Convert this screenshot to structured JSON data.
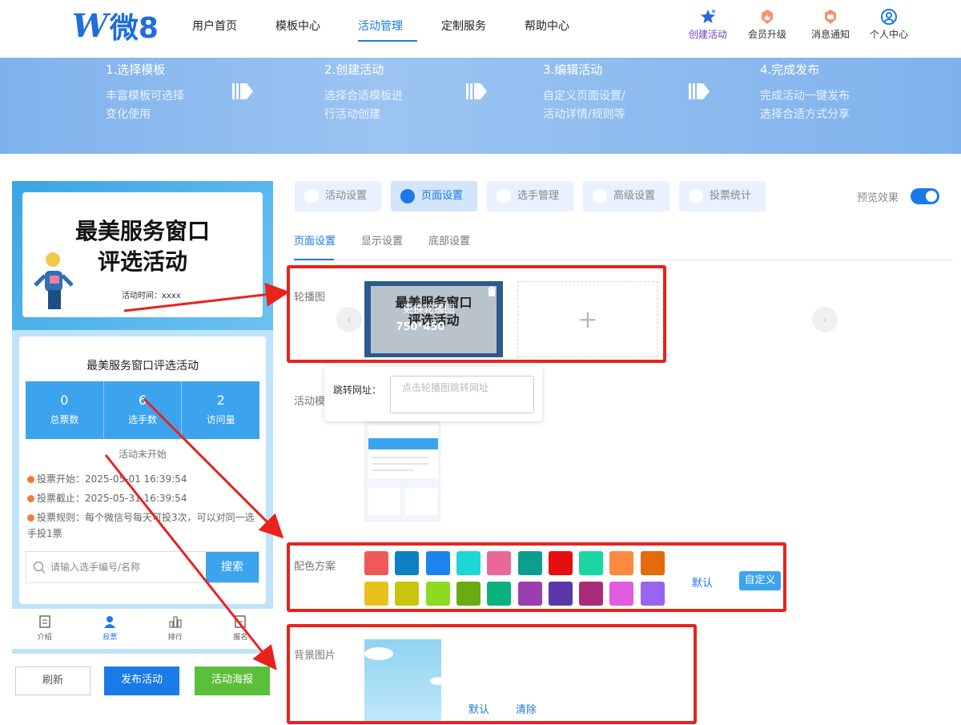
{
  "nav": {
    "logo_mark": "W",
    "logo_text": "微8",
    "links": [
      "用户首页",
      "模板中心",
      "活动管理",
      "定制服务",
      "帮助中心"
    ],
    "right_items": [
      "创建活动",
      "会员升级",
      "消息通知",
      "个人中心"
    ]
  },
  "steps": [
    {
      "title": "1.选择模板",
      "desc1": "丰富模板可选择",
      "desc2": "变化使用"
    },
    {
      "title": "2.创建活动",
      "desc1": "选择合适模板进",
      "desc2": "行活动创建"
    },
    {
      "title": "3.编辑活动",
      "desc1": "自定义页面设置/",
      "desc2": "活动详情/规则等"
    },
    {
      "title": "4.完成发布",
      "desc1": "完成活动一键发布",
      "desc2": "选择合适方式分享"
    }
  ],
  "preview": {
    "banner_title_1": "最美服务窗口",
    "banner_title_2": "评选活动",
    "banner_time": "活动时间：xxxx",
    "activity_name": "最美服务窗口评选活动",
    "stats": [
      {
        "value": "0",
        "label": "总票数"
      },
      {
        "value": "6",
        "label": "选手数"
      },
      {
        "value": "2",
        "label": "访问量"
      }
    ],
    "status": "活动未开始",
    "rules": [
      "投票开始：2025-05-01 16:39:54",
      "投票截止：2025-05-31 16:39:54",
      "投票规则：每个微信号每天可投3次，可以对同一选手投1票"
    ],
    "search_placeholder": "请输入选手编号/名称",
    "search_button": "搜索",
    "tabbar": [
      "介绍",
      "投票",
      "排行",
      "报名"
    ],
    "buttons": [
      "刷新",
      "发布活动",
      "活动海报"
    ]
  },
  "settings": {
    "top_tabs": [
      "活动设置",
      "页面设置",
      "选手管理",
      "高级设置",
      "投票统计"
    ],
    "preview_toggle_label": "预览效果",
    "sub_tabs": [
      "页面设置",
      "显示设置",
      "底部设置"
    ],
    "carousel_label": "轮播图",
    "carousel_overlay": "更换轮播图",
    "carousel_size": "750*450",
    "carousel_thumb_title_1": "最美服务窗口",
    "carousel_thumb_title_2": "评选活动",
    "add_symbol": "+",
    "prev_symbol": "‹",
    "next_symbol": "›",
    "jump_label": "跳转网址：",
    "jump_placeholder": "点击轮播图跳转网址",
    "template_label": "活动模",
    "color_label": "配色方案",
    "colors": [
      "#f0595a",
      "#0e7fc2",
      "#1b84f0",
      "#1dd6d6",
      "#e8689a",
      "#0d9e8e",
      "#e50f0f",
      "#1ad6a4",
      "#fb8a40",
      "#e46a0a",
      "#e8c11c",
      "#c9c40d",
      "#8ddb1f",
      "#6aaa13",
      "#0bb37c",
      "#9a3fae",
      "#5a37a9",
      "#a82d79",
      "#e05ce0",
      "#9a63f0"
    ],
    "color_default": "默认",
    "color_custom": "自定义",
    "bg_label": "背景图片",
    "bg_default": "默认",
    "bg_clear": "清除"
  }
}
